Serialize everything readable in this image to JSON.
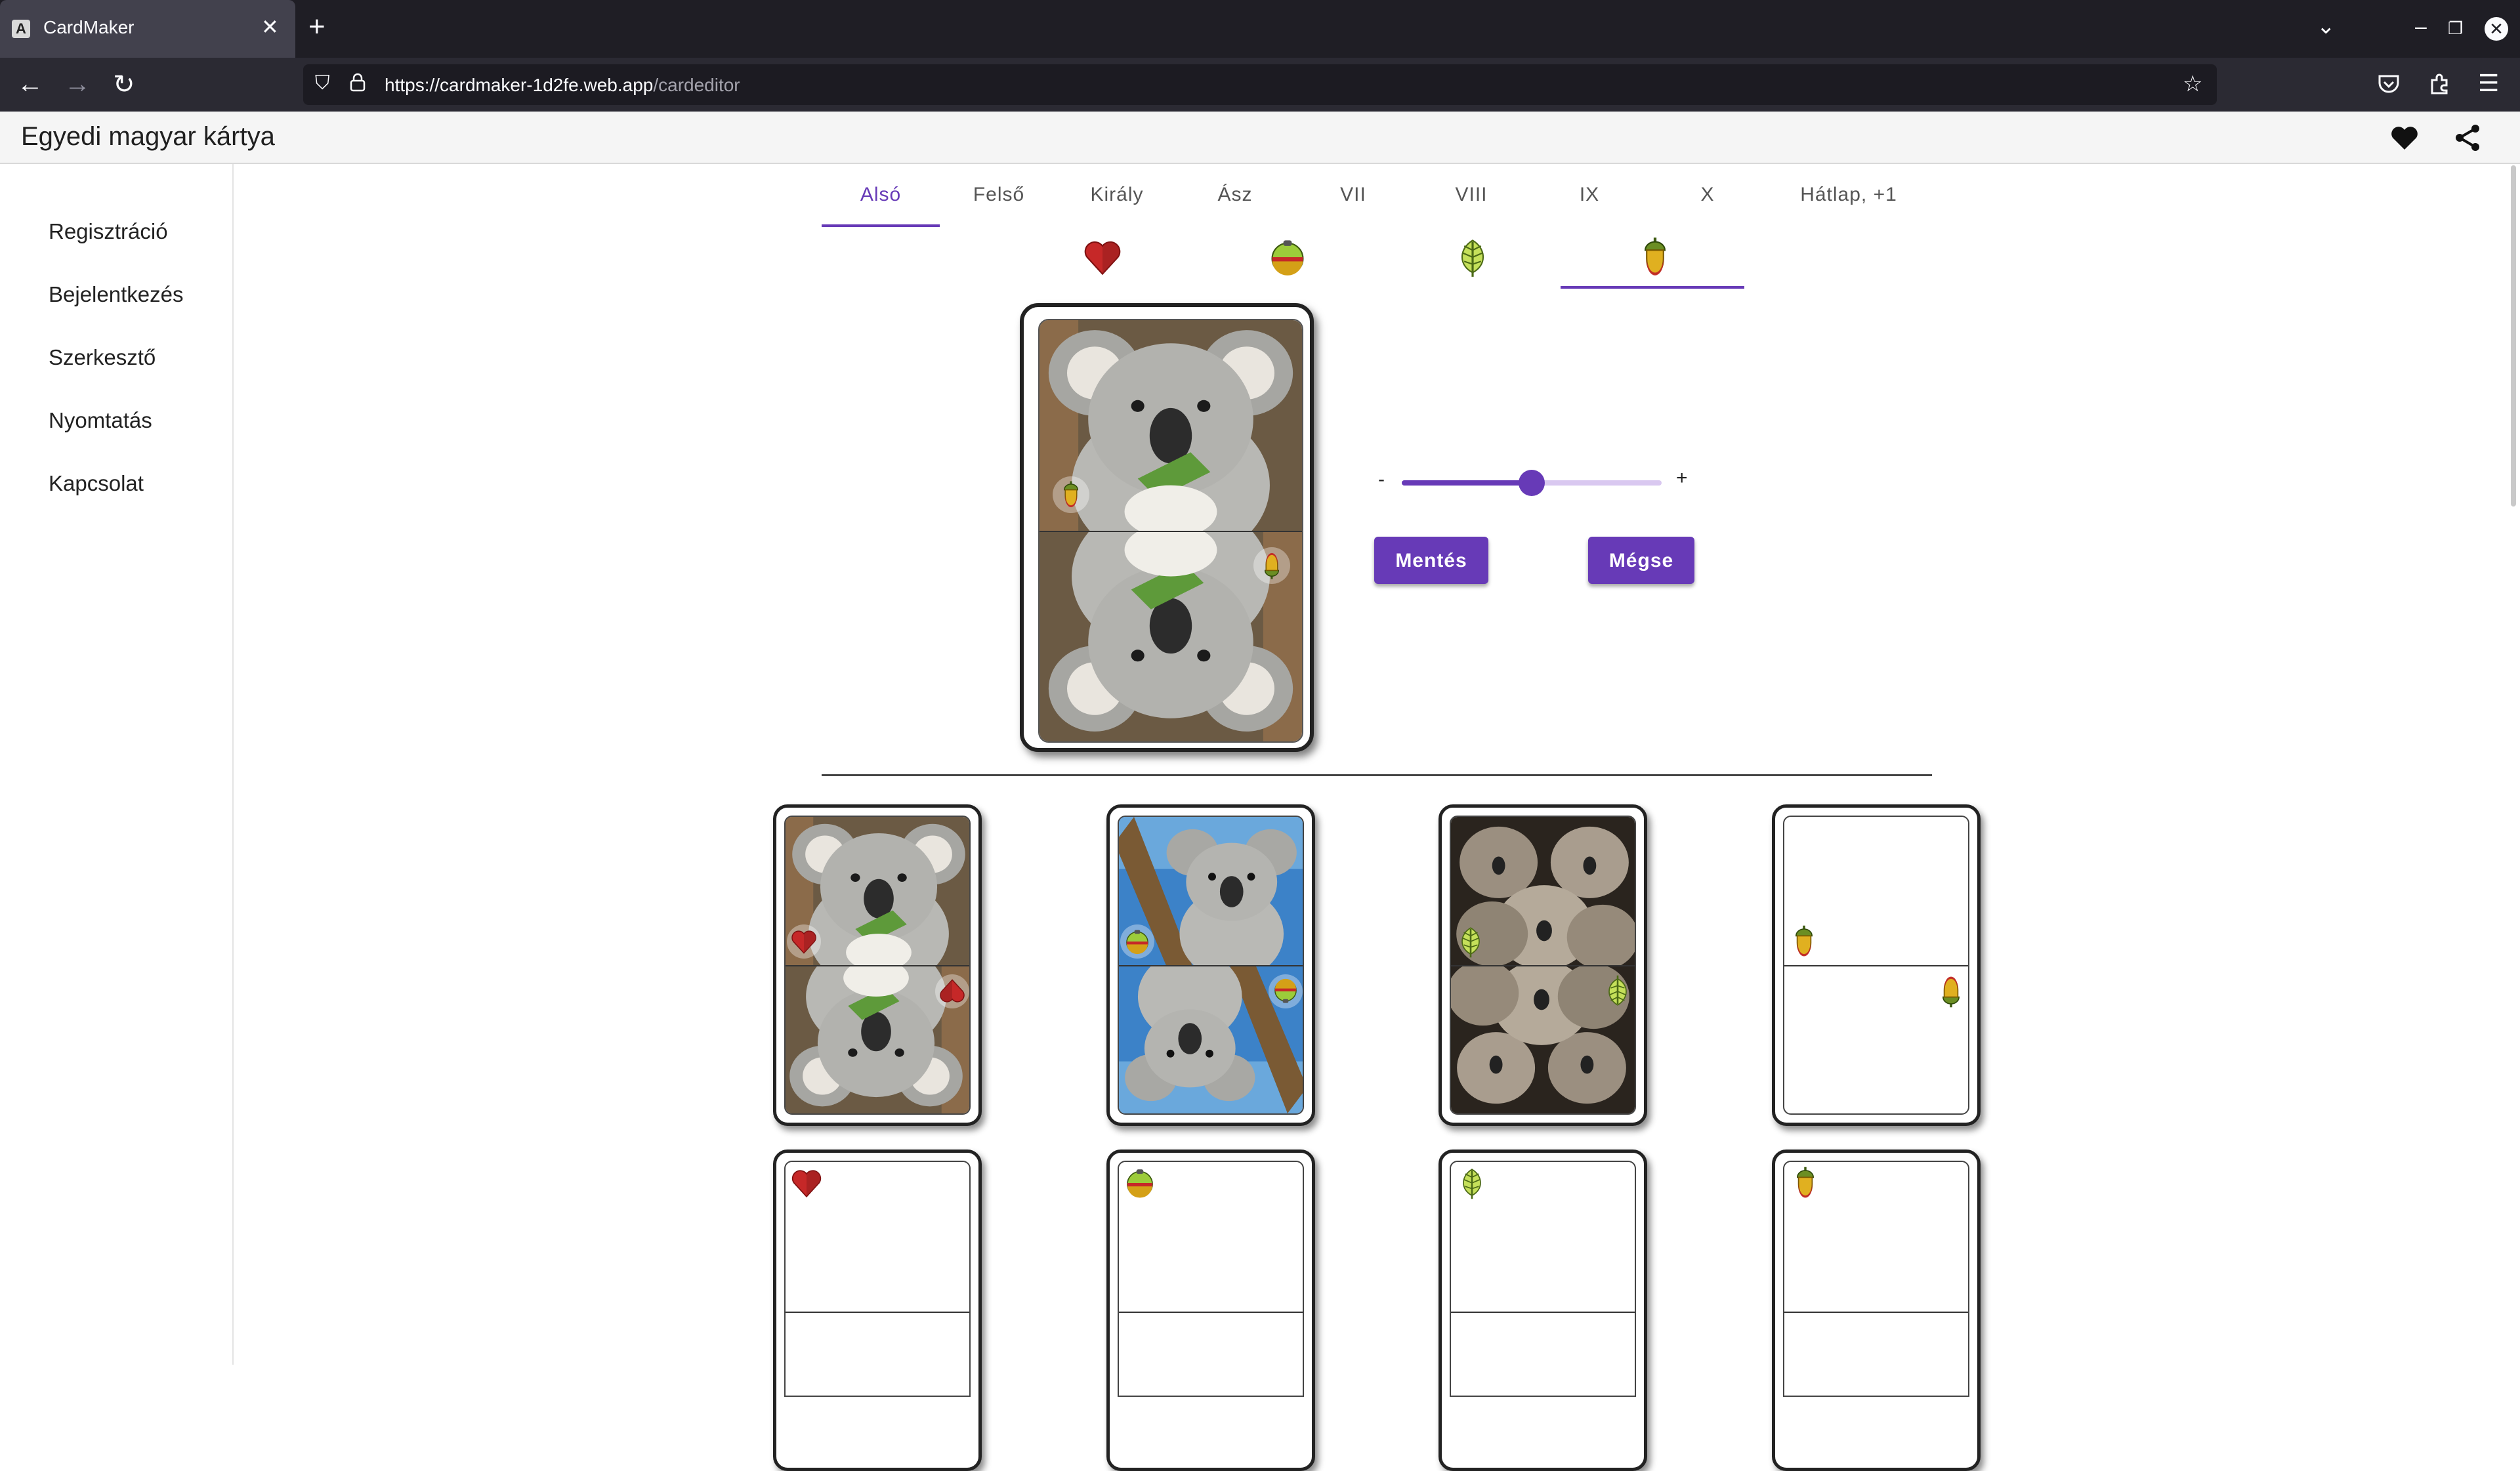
{
  "browser": {
    "tab_title": "CardMaker",
    "tab_favicon": "A",
    "url_host": "https://cardmaker-1d2fe.web.app",
    "url_path": "/cardeditor"
  },
  "app": {
    "title": "Egyedi magyar kártya"
  },
  "sidebar": {
    "items": [
      {
        "label": "Regisztráció"
      },
      {
        "label": "Bejelentkezés"
      },
      {
        "label": "Szerkesztő"
      },
      {
        "label": "Nyomtatás"
      },
      {
        "label": "Kapcsolat"
      }
    ]
  },
  "card_tabs": [
    {
      "label": "Alsó",
      "active": true
    },
    {
      "label": "Felső"
    },
    {
      "label": "Király"
    },
    {
      "label": "Ász"
    },
    {
      "label": "VII"
    },
    {
      "label": "VIII"
    },
    {
      "label": "IX"
    },
    {
      "label": "X"
    },
    {
      "label": "Hátlap, +1"
    }
  ],
  "suit_tabs": [
    {
      "icon": "heart-suit-icon"
    },
    {
      "icon": "bell-suit-icon"
    },
    {
      "icon": "leaf-suit-icon"
    },
    {
      "icon": "acorn-suit-icon",
      "active": true
    }
  ],
  "editor": {
    "slider_minus": "-",
    "slider_plus": "+",
    "slider_value": 0.5,
    "save_label": "Mentés",
    "cancel_label": "Mégse"
  },
  "colors": {
    "accent": "#673ab7",
    "heart": "#c62828",
    "leaf": "#9ccc3a",
    "acorn": "#d4a017"
  }
}
